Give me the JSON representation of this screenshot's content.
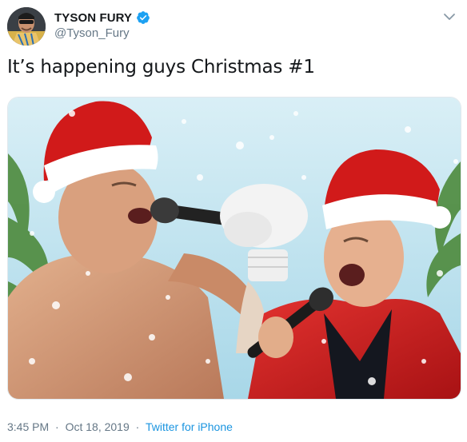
{
  "author": {
    "display_name": "TYSON FURY",
    "handle": "@Tyson_Fury",
    "verified_icon": "verified-badge-icon",
    "avatar_icon": "profile-photo"
  },
  "tweet": {
    "text": "It’s happening guys Christmas #1"
  },
  "media": {
    "kind": "photo"
  },
  "meta": {
    "time": "3:45 PM",
    "date": "Oct 18, 2019",
    "separator": "·",
    "source": "Twitter for iPhone"
  },
  "colors": {
    "verified": "#1da1f2",
    "link": "#1b95e0",
    "muted": "#657786",
    "text": "#14171a",
    "santa_red": "#d11a1a",
    "sky": "#bfe3ef"
  }
}
